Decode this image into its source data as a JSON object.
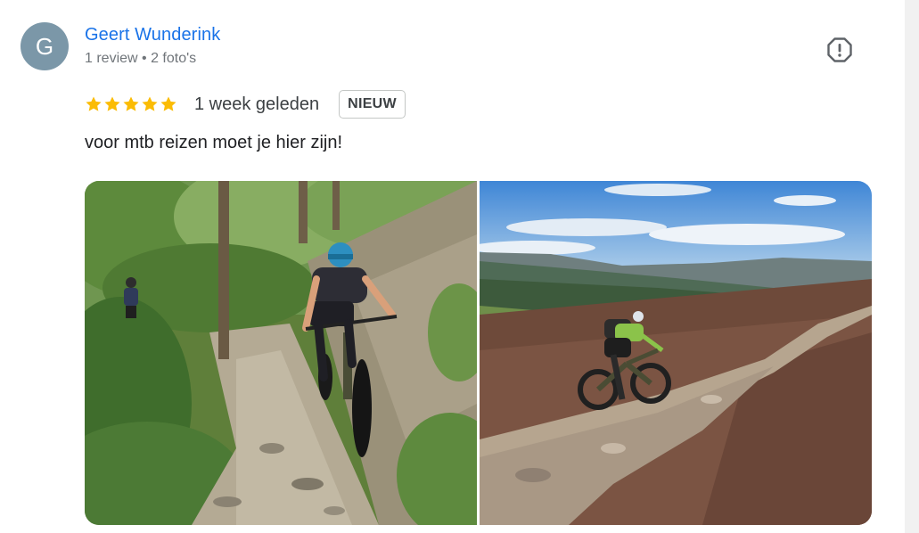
{
  "reviewer": {
    "initial": "G",
    "name": "Geert Wunderink",
    "meta": "1 review • 2 foto's"
  },
  "rating": {
    "stars": 5,
    "max_stars": 5,
    "date": "1 week geleden",
    "badge": "NIEUW"
  },
  "review": {
    "text": "voor mtb reizen moet je hier zijn!"
  },
  "photos": [
    {
      "description": "mountain bikers riding a rocky forest trail"
    },
    {
      "description": "mountain biker riding a moorland trail with hills in the distance"
    }
  ],
  "icons": {
    "report": "exclamation-octagon-icon",
    "star": "star-icon"
  },
  "colors": {
    "name_link": "#1a73e8",
    "star": "#fbbc04",
    "avatar_bg": "#7b97a8",
    "meta_text": "#70757a"
  }
}
